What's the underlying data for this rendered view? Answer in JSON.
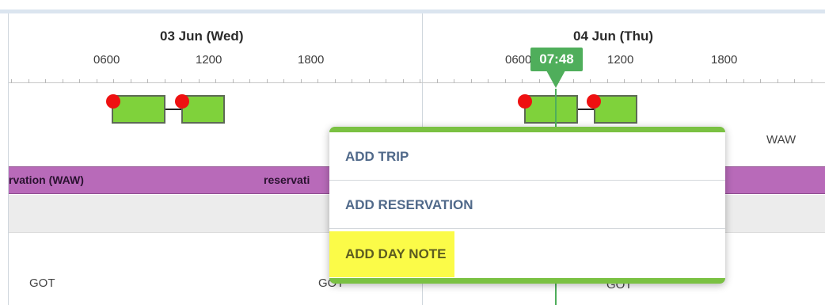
{
  "timeline": {
    "days": [
      {
        "date_label": "03 Jun (Wed)",
        "ticks": [
          "0600",
          "1200",
          "1800"
        ]
      },
      {
        "date_label": "04 Jun (Thu)",
        "ticks": [
          "0600",
          "1200",
          "1800"
        ]
      }
    ],
    "current_time": "07:48",
    "airports": {
      "day2_top": "WAW",
      "bottom_left": "GOT",
      "bottom_mid": "GOT",
      "bottom_right": "GOT"
    },
    "reservations": [
      "rvation (WAW)",
      "reservati"
    ]
  },
  "context_menu": {
    "items": [
      "ADD TRIP",
      "ADD RESERVATION",
      "ADD DAY NOTE"
    ],
    "highlighted_index": 2
  },
  "colors": {
    "trip_fill": "#7fd23b",
    "reservation_bar": "#b86ab9",
    "now_marker": "#4fae5b",
    "menu_accent": "#7ac142",
    "highlight": "#fbfb48",
    "menu_text": "#50698a"
  }
}
